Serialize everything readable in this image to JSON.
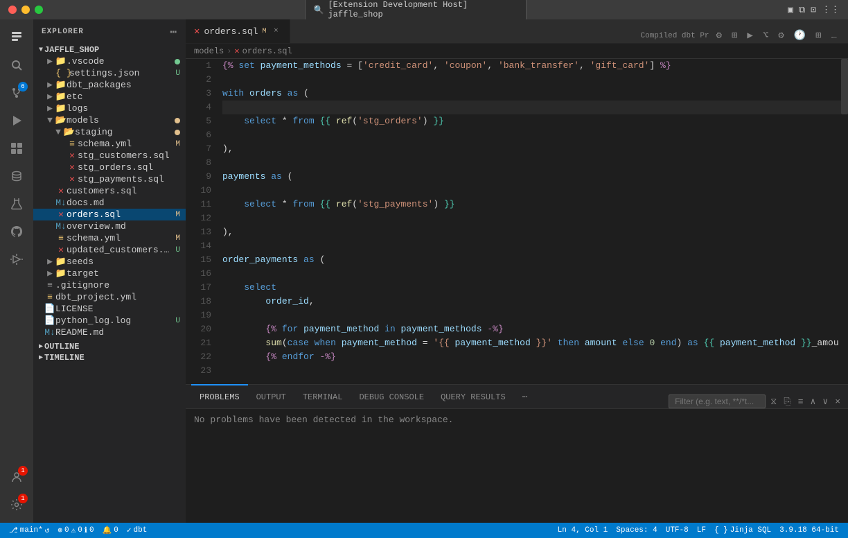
{
  "titlebar": {
    "search_text": "[Extension Development Host] jaffle_shop",
    "search_icon": "🔍"
  },
  "sidebar": {
    "header": "EXPLORER",
    "root": "JAFFLE_SHOP",
    "items": [
      {
        "id": "vscode",
        "label": ".vscode",
        "type": "folder",
        "indent": 1,
        "dot": "green"
      },
      {
        "id": "settings-json",
        "label": "settings.json",
        "type": "json",
        "indent": 2,
        "badge": "U"
      },
      {
        "id": "dbt-packages",
        "label": "dbt_packages",
        "type": "folder",
        "indent": 1
      },
      {
        "id": "etc",
        "label": "etc",
        "type": "folder",
        "indent": 1
      },
      {
        "id": "logs",
        "label": "logs",
        "type": "folder",
        "indent": 1
      },
      {
        "id": "models",
        "label": "models",
        "type": "folder",
        "indent": 1,
        "dot": "orange"
      },
      {
        "id": "staging",
        "label": "staging",
        "type": "folder",
        "indent": 2,
        "dot": "orange"
      },
      {
        "id": "schema-yml",
        "label": "schema.yml",
        "type": "yaml",
        "indent": 3,
        "badge": "M"
      },
      {
        "id": "stg-customers",
        "label": "stg_customers.sql",
        "type": "sql-dbt",
        "indent": 3
      },
      {
        "id": "stg-orders",
        "label": "stg_orders.sql",
        "type": "sql-dbt",
        "indent": 3
      },
      {
        "id": "stg-payments",
        "label": "stg_payments.sql",
        "type": "sql-dbt",
        "indent": 3
      },
      {
        "id": "customers-sql",
        "label": "customers.sql",
        "type": "sql-dbt",
        "indent": 2
      },
      {
        "id": "docs-md",
        "label": "docs.md",
        "type": "md",
        "indent": 2
      },
      {
        "id": "orders-sql",
        "label": "orders.sql",
        "type": "sql-dbt",
        "indent": 2,
        "badge": "M",
        "selected": true
      },
      {
        "id": "overview-md",
        "label": "overview.md",
        "type": "md",
        "indent": 2
      },
      {
        "id": "schema-yml2",
        "label": "schema.yml",
        "type": "yaml",
        "indent": 2,
        "badge": "M"
      },
      {
        "id": "updated-customers",
        "label": "updated_customers...",
        "type": "sql-dbt",
        "indent": 2,
        "badge": "U"
      },
      {
        "id": "seeds",
        "label": "seeds",
        "type": "folder",
        "indent": 1
      },
      {
        "id": "target",
        "label": "target",
        "type": "folder",
        "indent": 1
      },
      {
        "id": "gitignore",
        "label": ".gitignore",
        "type": "txt",
        "indent": 1
      },
      {
        "id": "dbt-project",
        "label": "dbt_project.yml",
        "type": "yaml",
        "indent": 1
      },
      {
        "id": "license",
        "label": "LICENSE",
        "type": "txt",
        "indent": 1
      },
      {
        "id": "python-log",
        "label": "python_log.log",
        "type": "txt",
        "indent": 1,
        "badge": "U"
      },
      {
        "id": "readme",
        "label": "README.md",
        "type": "md",
        "indent": 1
      }
    ]
  },
  "tabs": [
    {
      "id": "orders-sql",
      "label": "orders.sql",
      "modified": true,
      "active": true,
      "type": "sql-dbt"
    }
  ],
  "breadcrumb": {
    "parts": [
      "models",
      "orders.sql"
    ]
  },
  "editor": {
    "lines": [
      {
        "num": 1,
        "content": "{% set payment_methods = ['credit_card', 'coupon', 'bank_transfer', 'gift_card'] %}"
      },
      {
        "num": 2,
        "content": ""
      },
      {
        "num": 3,
        "content": "with orders as ("
      },
      {
        "num": 4,
        "content": ""
      },
      {
        "num": 5,
        "content": "    select * from {{ ref('stg_orders') }}"
      },
      {
        "num": 6,
        "content": ""
      },
      {
        "num": 7,
        "content": "),"
      },
      {
        "num": 8,
        "content": ""
      },
      {
        "num": 9,
        "content": "payments as ("
      },
      {
        "num": 10,
        "content": ""
      },
      {
        "num": 11,
        "content": "    select * from {{ ref('stg_payments') }}"
      },
      {
        "num": 12,
        "content": ""
      },
      {
        "num": 13,
        "content": "),"
      },
      {
        "num": 14,
        "content": ""
      },
      {
        "num": 15,
        "content": "order_payments as ("
      },
      {
        "num": 16,
        "content": ""
      },
      {
        "num": 17,
        "content": "    select"
      },
      {
        "num": 18,
        "content": "        order_id,"
      },
      {
        "num": 19,
        "content": ""
      },
      {
        "num": 20,
        "content": "        {% for payment_method in payment_methods -%}"
      },
      {
        "num": 21,
        "content": "        sum(case when payment_method = '{{ payment_method }}' then amount else 0 end) as {{ payment_method }}_amou"
      },
      {
        "num": 22,
        "content": "        {% endfor -%}"
      },
      {
        "num": 23,
        "content": ""
      }
    ]
  },
  "panel": {
    "tabs": [
      {
        "id": "problems",
        "label": "PROBLEMS",
        "active": true
      },
      {
        "id": "output",
        "label": "OUTPUT",
        "active": false
      },
      {
        "id": "terminal",
        "label": "TERMINAL",
        "active": false
      },
      {
        "id": "debug",
        "label": "DEBUG CONSOLE",
        "active": false
      },
      {
        "id": "query",
        "label": "QUERY RESULTS",
        "active": false
      }
    ],
    "filter_placeholder": "Filter (e.g. text, **/*t...",
    "message": "No problems have been detected in the workspace."
  },
  "statusbar": {
    "branch": "main*",
    "sync_icon": "↺",
    "errors": "0",
    "warnings": "0",
    "info": "0",
    "notifications": "0",
    "dbt": "dbt",
    "line_col": "Ln 4, Col 1",
    "spaces": "Spaces: 4",
    "encoding": "UTF-8",
    "line_ending": "LF",
    "language": "Jinja SQL",
    "version": "3.9.18 64-bit"
  },
  "outline": {
    "label": "OUTLINE"
  },
  "timeline": {
    "label": "TIMELINE"
  }
}
